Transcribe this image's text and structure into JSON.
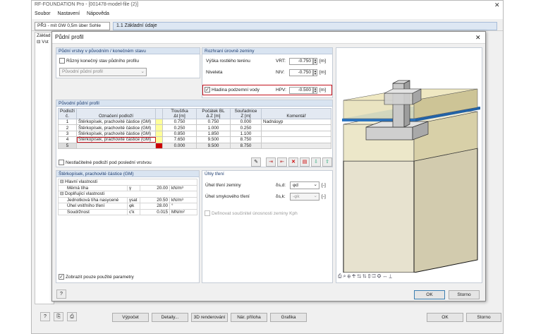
{
  "app": {
    "title": "RF-FOUNDATION Pro - [001478-model-file (2)]",
    "menu": [
      "Soubor",
      "Nastavení",
      "Nápověda"
    ],
    "case_select": "PŘ3 - mít GW 0,5m über Sohle",
    "section_header": "1.1 Základní údaje",
    "tree_root": "Základ",
    "tree_child": "Vst",
    "bottom_buttons": {
      "calc": "Výpočet",
      "details": "Detaily...",
      "render3d": "3D renderování",
      "annex": "Nár. příloha",
      "graphics": "Grafika",
      "ok": "OK",
      "cancel": "Storno"
    }
  },
  "dialog": {
    "title": "Půdní profil",
    "layers_group": {
      "title": "Půdní vrstvy v původním / konečném stavu",
      "diff_final_label": "Různý konečný stav půdního profilu",
      "profile_select": "Původní půdní profil"
    },
    "terrain_group": {
      "title": "Rozhraní úrovně zeminy",
      "terrain_height_label": "Výška rostlého terénu",
      "terrain_height_sym": "VRT:",
      "terrain_height_value": "-0.750",
      "terrain_height_unit": "[m]",
      "level_label": "Niveleta",
      "level_sym": "NIV:",
      "level_value": "-0.750",
      "level_unit": "[m]",
      "gw_label": "Hladina podzemní vody",
      "gw_sym": "HPV:",
      "gw_value": "-0.500",
      "gw_unit": "[m]"
    },
    "profile_group": {
      "title": "Původní půdní profil",
      "columns": {
        "no1": "Podloží",
        "no2": "č.",
        "name": "Označení podloží",
        "thick1": "Tloušťka",
        "thick2": "Δt [m]",
        "start1": "Počátek BL",
        "start2": "Δ Z [m]",
        "coord1": "Souřadnice",
        "coord2": "Z [m]",
        "comment": "Komentář"
      },
      "rows": [
        {
          "no": "1",
          "name": "Štěrkopísek, prachovité částice (GM)",
          "thick": "0.750",
          "start": "0.750",
          "coord": "0.000",
          "comment": "Nadnásyp",
          "color": "#ffff99"
        },
        {
          "no": "2",
          "name": "Štěrkopísek, prachovité částice (GM)",
          "thick": "0.250",
          "start": "1.000",
          "coord": "0.250",
          "comment": "",
          "color": "#ffff99"
        },
        {
          "no": "3",
          "name": "Štěrkopísek, prachovité částice (GM)",
          "thick": "0.850",
          "start": "1.850",
          "coord": "1.100",
          "comment": "",
          "color": "#ffff99"
        },
        {
          "no": "4",
          "name": "Štěrkopísek, prachovité částice (GM)",
          "thick": "7.650",
          "start": "9.500",
          "coord": "8.750",
          "comment": "",
          "color": "#ffff99"
        },
        {
          "no": "5",
          "name": "",
          "thick": "0.000",
          "start": "9.500",
          "coord": "8.750",
          "comment": "",
          "color": "#cc0000"
        }
      ],
      "infinite_label": "Nestlačitelné podloží pod poslední vrstvou"
    },
    "props_group": {
      "title": "Štěrkopísek, prachovité částice (GM)",
      "main_header": "Hlavní vlastnosti",
      "unit_weight_label": "Měrná tíha",
      "unit_weight_sym": "γ",
      "unit_weight_value": "20.00",
      "unit_weight_unit": "kN/m³",
      "extra_header": "Doplňující vlastnosti",
      "rows": [
        {
          "label": "Jednotková tíha nasycené",
          "sym": "γsat",
          "value": "20.50",
          "unit": "kN/m³"
        },
        {
          "label": "Úhel vnitřního tření",
          "sym": "φk",
          "value": "28.00",
          "unit": "°"
        },
        {
          "label": "Soudržnost",
          "sym": "c'k",
          "value": "0.015",
          "unit": "MN/m²"
        }
      ],
      "show_used_label": "Zobrazit pouze použité parametry"
    },
    "friction_group": {
      "title": "Úhly tření",
      "soil_angle_label": "Úhel tření zeminy",
      "soil_angle_sym": "δs,d:",
      "soil_angle_value": "φd",
      "soil_angle_unit": "[-]",
      "shear_angle_label": "Úhel smykového tření",
      "shear_angle_sym": "δs,k:",
      "shear_angle_value": "-φk",
      "shear_angle_unit": "[-]",
      "kph_label": "Definovat součinitel únosnosti zeminy Kph"
    },
    "buttons": {
      "ok": "OK",
      "cancel": "Storno"
    }
  },
  "colors": {
    "accent": "#3c7fb1",
    "highlight_red": "#c3131d",
    "water": "#3f95e2"
  }
}
